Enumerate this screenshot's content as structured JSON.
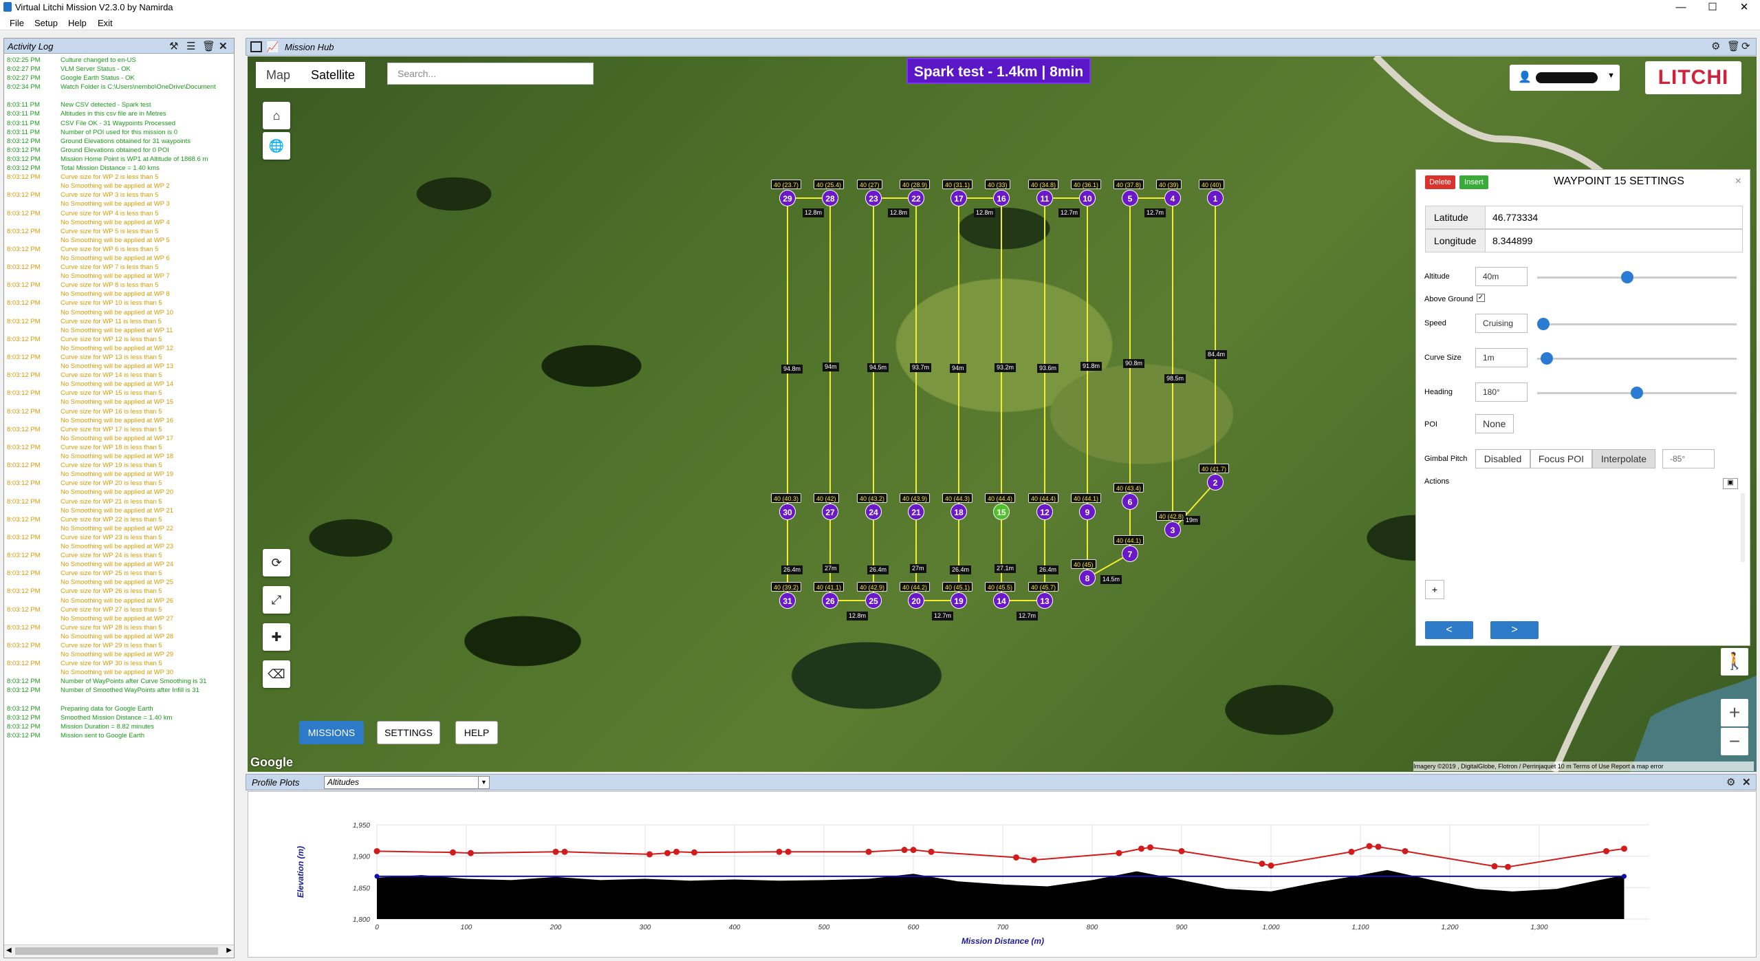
{
  "window": {
    "title": "Virtual Litchi Mission V2.3.0 by Namirda"
  },
  "menu": [
    "File",
    "Setup",
    "Help",
    "Exit"
  ],
  "log": {
    "title": "Activity Log",
    "rows": [
      [
        "8:02:25 PM",
        "Culture changed to en-US",
        "g"
      ],
      [
        "8:02:27 PM",
        "VLM Server Status - OK",
        "g"
      ],
      [
        "8:02:27 PM",
        "Google Earth Status - OK",
        "g"
      ],
      [
        "8:02:34 PM",
        "Watch Folder is C:\\Users\\nembo\\OneDrive\\Document",
        "g"
      ],
      [
        "",
        "",
        ""
      ],
      [
        "8:03:11 PM",
        "New CSV detected - Spark test",
        "g"
      ],
      [
        "8:03:11 PM",
        "Altitudes in this csv file are in Metres",
        "g"
      ],
      [
        "8:03:11 PM",
        "CSV File OK - 31 Waypoints Processed",
        "g"
      ],
      [
        "8:03:11 PM",
        "Number of POI used for this mission is 0",
        "g"
      ],
      [
        "8:03:12 PM",
        "Ground Elevations obtained for 31 waypoints",
        "g"
      ],
      [
        "8:03:12 PM",
        "Ground Elevations obtained for 0 POI",
        "g"
      ],
      [
        "8:03:12 PM",
        "Mission Home Point is WP1 at Altitude of 1868.6 m",
        "g"
      ],
      [
        "8:03:12 PM",
        "Total Mission Distance = 1.40 kms",
        "g"
      ],
      [
        "8:03:12 PM",
        "Curve size for WP 2 is less than 5",
        "o"
      ],
      [
        "",
        "No Smoothing will be applied at WP 2",
        "o"
      ],
      [
        "8:03:12 PM",
        "Curve size for WP 3 is less than 5",
        "o"
      ],
      [
        "",
        "No Smoothing will be applied at WP 3",
        "o"
      ],
      [
        "8:03:12 PM",
        "Curve size for WP 4 is less than 5",
        "o"
      ],
      [
        "",
        "No Smoothing will be applied at WP 4",
        "o"
      ],
      [
        "8:03:12 PM",
        "Curve size for WP 5 is less than 5",
        "o"
      ],
      [
        "",
        "No Smoothing will be applied at WP 5",
        "o"
      ],
      [
        "8:03:12 PM",
        "Curve size for WP 6 is less than 5",
        "o"
      ],
      [
        "",
        "No Smoothing will be applied at WP 6",
        "o"
      ],
      [
        "8:03:12 PM",
        "Curve size for WP 7 is less than 5",
        "o"
      ],
      [
        "",
        "No Smoothing will be applied at WP 7",
        "o"
      ],
      [
        "8:03:12 PM",
        "Curve size for WP 8 is less than 5",
        "o"
      ],
      [
        "",
        "No Smoothing will be applied at WP 8",
        "o"
      ],
      [
        "8:03:12 PM",
        "Curve size for WP 10 is less than 5",
        "o"
      ],
      [
        "",
        "No Smoothing will be applied at WP 10",
        "o"
      ],
      [
        "8:03:12 PM",
        "Curve size for WP 11 is less than 5",
        "o"
      ],
      [
        "",
        "No Smoothing will be applied at WP 11",
        "o"
      ],
      [
        "8:03:12 PM",
        "Curve size for WP 12 is less than 5",
        "o"
      ],
      [
        "",
        "No Smoothing will be applied at WP 12",
        "o"
      ],
      [
        "8:03:12 PM",
        "Curve size for WP 13 is less than 5",
        "o"
      ],
      [
        "",
        "No Smoothing will be applied at WP 13",
        "o"
      ],
      [
        "8:03:12 PM",
        "Curve size for WP 14 is less than 5",
        "o"
      ],
      [
        "",
        "No Smoothing will be applied at WP 14",
        "o"
      ],
      [
        "8:03:12 PM",
        "Curve size for WP 15 is less than 5",
        "o"
      ],
      [
        "",
        "No Smoothing will be applied at WP 15",
        "o"
      ],
      [
        "8:03:12 PM",
        "Curve size for WP 16 is less than 5",
        "o"
      ],
      [
        "",
        "No Smoothing will be applied at WP 16",
        "o"
      ],
      [
        "8:03:12 PM",
        "Curve size for WP 17 is less than 5",
        "o"
      ],
      [
        "",
        "No Smoothing will be applied at WP 17",
        "o"
      ],
      [
        "8:03:12 PM",
        "Curve size for WP 18 is less than 5",
        "o"
      ],
      [
        "",
        "No Smoothing will be applied at WP 18",
        "o"
      ],
      [
        "8:03:12 PM",
        "Curve size for WP 19 is less than 5",
        "o"
      ],
      [
        "",
        "No Smoothing will be applied at WP 19",
        "o"
      ],
      [
        "8:03:12 PM",
        "Curve size for WP 20 is less than 5",
        "o"
      ],
      [
        "",
        "No Smoothing will be applied at WP 20",
        "o"
      ],
      [
        "8:03:12 PM",
        "Curve size for WP 21 is less than 5",
        "o"
      ],
      [
        "",
        "No Smoothing will be applied at WP 21",
        "o"
      ],
      [
        "8:03:12 PM",
        "Curve size for WP 22 is less than 5",
        "o"
      ],
      [
        "",
        "No Smoothing will be applied at WP 22",
        "o"
      ],
      [
        "8:03:12 PM",
        "Curve size for WP 23 is less than 5",
        "o"
      ],
      [
        "",
        "No Smoothing will be applied at WP 23",
        "o"
      ],
      [
        "8:03:12 PM",
        "Curve size for WP 24 is less than 5",
        "o"
      ],
      [
        "",
        "No Smoothing will be applied at WP 24",
        "o"
      ],
      [
        "8:03:12 PM",
        "Curve size for WP 25 is less than 5",
        "o"
      ],
      [
        "",
        "No Smoothing will be applied at WP 25",
        "o"
      ],
      [
        "8:03:12 PM",
        "Curve size for WP 26 is less than 5",
        "o"
      ],
      [
        "",
        "No Smoothing will be applied at WP 26",
        "o"
      ],
      [
        "8:03:12 PM",
        "Curve size for WP 27 is less than 5",
        "o"
      ],
      [
        "",
        "No Smoothing will be applied at WP 27",
        "o"
      ],
      [
        "8:03:12 PM",
        "Curve size for WP 28 is less than 5",
        "o"
      ],
      [
        "",
        "No Smoothing will be applied at WP 28",
        "o"
      ],
      [
        "8:03:12 PM",
        "Curve size for WP 29 is less than 5",
        "o"
      ],
      [
        "",
        "No Smoothing will be applied at WP 29",
        "o"
      ],
      [
        "8:03:12 PM",
        "Curve size for WP 30 is less than 5",
        "o"
      ],
      [
        "",
        "No Smoothing will be applied at WP 30",
        "o"
      ],
      [
        "8:03:12 PM",
        "Number of WayPoints after Curve Smoothing is 31",
        "g"
      ],
      [
        "8:03:12 PM",
        "Number of Smoothed WayPoints after Infill  is 31",
        "g"
      ],
      [
        "",
        "",
        ""
      ],
      [
        "8:03:12 PM",
        "Preparing data for Google Earth",
        "g"
      ],
      [
        "8:03:12 PM",
        "Smoothed Mission Distance = 1.40 km",
        "g"
      ],
      [
        "8:03:12 PM",
        "Mission Duration = 8.82 minutes",
        "g"
      ],
      [
        "8:03:12 PM",
        "Mission sent to Google Earth",
        "g"
      ]
    ]
  },
  "hub": {
    "title": "Mission Hub",
    "map_tab": "Map",
    "satellite_tab": "Satellite",
    "search_placeholder": "Search...",
    "mission_title": "Spark test - 1.4km | 8min",
    "logo": "LITCHI",
    "buttons": {
      "missions": "MISSIONS",
      "settings": "SETTINGS",
      "help": "HELP"
    },
    "google": "Google",
    "attribution": "Imagery ©2019 , DigitalGlobe, Flotron / Perrinjaquet   10 m   Terms of Use   Report a map error",
    "waypoints": [
      {
        "n": "29",
        "lbl": "40 (23.7)"
      },
      {
        "n": "28",
        "lbl": "40 (25.4)"
      },
      {
        "n": "23",
        "lbl": "40 (27)"
      },
      {
        "n": "22",
        "lbl": "40 (28.9)"
      },
      {
        "n": "17",
        "lbl": "40 (31.1)"
      },
      {
        "n": "16",
        "lbl": "40 (33)"
      },
      {
        "n": "11",
        "lbl": "40 (34.8)"
      },
      {
        "n": "10",
        "lbl": "40 (36.1)"
      },
      {
        "n": "5",
        "lbl": "40 (37.8)"
      },
      {
        "n": "4",
        "lbl": "40 (39)"
      },
      {
        "n": "1",
        "lbl": "40 (40)"
      },
      {
        "n": "30",
        "lbl": "40 (40.3)"
      },
      {
        "n": "27",
        "lbl": "40 (42)"
      },
      {
        "n": "24",
        "lbl": "40 (43.2)"
      },
      {
        "n": "21",
        "lbl": "40 (43.9)"
      },
      {
        "n": "18",
        "lbl": "40 (44.3)"
      },
      {
        "n": "15",
        "lbl": "40 (44.4)"
      },
      {
        "n": "12",
        "lbl": "40 (44.4)"
      },
      {
        "n": "9",
        "lbl": "40 (44.1)"
      },
      {
        "n": "6",
        "lbl": "40 (43.4)"
      },
      {
        "n": "3",
        "lbl": "40 (42.8)"
      },
      {
        "n": "2",
        "lbl": "40 (41.7)"
      },
      {
        "n": "31",
        "lbl": "40 (39.2)"
      },
      {
        "n": "26",
        "lbl": "40 (41.1)"
      },
      {
        "n": "25",
        "lbl": "40 (42.9)"
      },
      {
        "n": "20",
        "lbl": "40 (44.2)"
      },
      {
        "n": "19",
        "lbl": "40 (45.1)"
      },
      {
        "n": "14",
        "lbl": "40 (45.5)"
      },
      {
        "n": "13",
        "lbl": "40 (45.7)"
      },
      {
        "n": "8",
        "lbl": "40 (45)"
      },
      {
        "n": "7",
        "lbl": "40 (44.1)"
      }
    ],
    "distances": [
      "12.8m",
      "12.8m",
      "12.8m",
      "12.7m",
      "12.7m",
      "94.8m",
      "94m",
      "94.5m",
      "93.7m",
      "94m",
      "93.2m",
      "93.6m",
      "91.8m",
      "90.8m",
      "98.5m",
      "84.4m",
      "26.4m",
      "27m",
      "26.4m",
      "27m",
      "26.4m",
      "27.1m",
      "26.4m",
      "12.8m",
      "12.7m",
      "12.7m",
      "14.5m",
      "19m"
    ]
  },
  "waypoint_settings": {
    "title": "WAYPOINT 15 SETTINGS",
    "delete": "Delete",
    "insert": "Insert",
    "latitude_label": "Latitude",
    "latitude": "46.773334",
    "longitude_label": "Longitude",
    "longitude": "8.344899",
    "altitude_label": "Altitude",
    "altitude": "40m",
    "altitude_level": 0.45,
    "above_ground_label": "Above Ground",
    "speed_label": "Speed",
    "speed": "Cruising",
    "speed_level": 0,
    "curve_label": "Curve Size",
    "curve": "1m",
    "curve_level": 0.02,
    "heading_label": "Heading",
    "heading": "180°",
    "heading_level": 0.5,
    "poi_label": "POI",
    "poi": "None",
    "gimbal_label": "Gimbal Pitch",
    "gimbal_options": [
      "Disabled",
      "Focus POI",
      "Interpolate"
    ],
    "gimbal_selected": "Interpolate",
    "gimbal_value": "-85°",
    "actions_label": "Actions",
    "add": "+",
    "prev": "<",
    "next": ">"
  },
  "profile": {
    "title": "Profile Plots",
    "select": "Altitudes"
  },
  "chart_data": {
    "type": "line",
    "xlabel": "Mission Distance (m)",
    "ylabel": "Elevation (m)",
    "xlim": [
      0,
      1400
    ],
    "ylim": [
      1800,
      1950
    ],
    "xticks": [
      "0",
      "100",
      "200",
      "300",
      "400",
      "500",
      "600",
      "700",
      "800",
      "900",
      "1,000",
      "1,100",
      "1,200",
      "1,300"
    ],
    "yticks": [
      "1,800",
      "1,850",
      "1,900",
      "1,950"
    ],
    "series": [
      {
        "color": "#d21c1c",
        "points": [
          [
            0,
            1908
          ],
          [
            85,
            1906
          ],
          [
            105,
            1905
          ],
          [
            200,
            1907
          ],
          [
            210,
            1907
          ],
          [
            305,
            1903
          ],
          [
            325,
            1905
          ],
          [
            335,
            1907
          ],
          [
            355,
            1906
          ],
          [
            450,
            1907
          ],
          [
            460,
            1907
          ],
          [
            550,
            1907
          ],
          [
            590,
            1910
          ],
          [
            600,
            1910
          ],
          [
            620,
            1907
          ],
          [
            715,
            1898
          ],
          [
            735,
            1894
          ],
          [
            830,
            1905
          ],
          [
            855,
            1912
          ],
          [
            865,
            1914
          ],
          [
            900,
            1908
          ],
          [
            990,
            1888
          ],
          [
            1000,
            1885
          ],
          [
            1090,
            1907
          ],
          [
            1110,
            1916
          ],
          [
            1120,
            1915
          ],
          [
            1150,
            1908
          ],
          [
            1250,
            1884
          ],
          [
            1265,
            1883
          ],
          [
            1375,
            1908
          ],
          [
            1395,
            1912
          ]
        ]
      },
      {
        "color": "#1010b0",
        "points": [
          [
            0,
            1868
          ],
          [
            1395,
            1868
          ]
        ]
      }
    ],
    "terrain": [
      [
        0,
        1866
      ],
      [
        50,
        1870
      ],
      [
        100,
        1864
      ],
      [
        150,
        1862
      ],
      [
        200,
        1867
      ],
      [
        250,
        1862
      ],
      [
        300,
        1864
      ],
      [
        350,
        1861
      ],
      [
        400,
        1863
      ],
      [
        450,
        1861
      ],
      [
        500,
        1862
      ],
      [
        550,
        1864
      ],
      [
        600,
        1872
      ],
      [
        650,
        1860
      ],
      [
        700,
        1855
      ],
      [
        750,
        1852
      ],
      [
        800,
        1862
      ],
      [
        850,
        1876
      ],
      [
        900,
        1862
      ],
      [
        950,
        1848
      ],
      [
        1000,
        1844
      ],
      [
        1050,
        1858
      ],
      [
        1100,
        1870
      ],
      [
        1130,
        1878
      ],
      [
        1180,
        1862
      ],
      [
        1230,
        1848
      ],
      [
        1270,
        1844
      ],
      [
        1320,
        1848
      ],
      [
        1360,
        1860
      ],
      [
        1395,
        1870
      ]
    ]
  }
}
